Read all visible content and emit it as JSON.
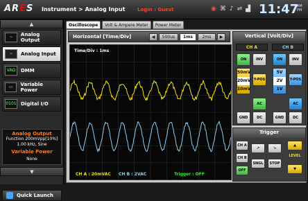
{
  "header": {
    "logo_text": "AR",
    "logo_accent": "E",
    "logo_tail": "S",
    "title": "Instrument > Analog Input",
    "login": "Login : Guest",
    "clock": "11:47",
    "ampm_top": "AM",
    "ampm_bottom": "PM"
  },
  "tray": {
    "icons": [
      "speaker-icon",
      "network-icon",
      "volume-icon",
      "usb-icon",
      "wifi-icon"
    ]
  },
  "sidebar": {
    "up_arrow": "▲",
    "down_arrow": "▼",
    "items": [
      {
        "label": "Analog Output",
        "icon": "~",
        "active": false
      },
      {
        "label": "Analog Input",
        "icon": "⌁",
        "active": true
      },
      {
        "label": "DMM",
        "icon": "VAΩ",
        "active": false
      },
      {
        "label": "Variable Power",
        "icon": "▭",
        "active": false
      },
      {
        "label": "Digital I/O",
        "icon": "0101",
        "active": false
      }
    ],
    "info": {
      "ao_title": "Analog Output",
      "ao_line1": "Function 200mVpp[10%]",
      "ao_line2": "1.00 kHz, Sine",
      "vp_title": "Variable Power",
      "vp_value": "None"
    },
    "quick_launch": "Quick Launch"
  },
  "tabs": [
    "Oscilloscope",
    "Volt & Ampere Meter",
    "Power Meter"
  ],
  "horizontal": {
    "title": "Horizontal [Time/Div]",
    "left": "◀",
    "right": "▶",
    "opt1": "500us",
    "opt2": "1ms",
    "opt3": "2ms",
    "selected": "1ms"
  },
  "scope": {
    "time_div_label": "Time/Div : 1ms",
    "cha_readout": "CH A : 20mVAC",
    "chb_readout": "CH B : 2VAC",
    "trigger_readout": "Trigger : OFF"
  },
  "vertical": {
    "title": "Vertical [Volt/Div]",
    "cha": "CH A",
    "chb": "CH B",
    "on": "ON",
    "inv": "INV",
    "ypos": "Y-POS",
    "ac": "AC",
    "gnd": "GND",
    "dc": "DC",
    "cha_volts": [
      "50mV",
      "20mV",
      "10mV"
    ],
    "chb_volts": [
      "5V",
      "2V",
      "1V"
    ]
  },
  "trigger": {
    "title": "Trigger",
    "cha": "CH A",
    "chb": "CH B",
    "off": "OFF",
    "single": "SNGL",
    "stop": "STOP",
    "level": "LEVEL",
    "up": "▲",
    "down": "▼",
    "rise": "↗",
    "fall": "↘"
  },
  "colors": {
    "cha": "#f0e020",
    "chb": "#8ecff5",
    "grid": "#2d2d2d"
  }
}
